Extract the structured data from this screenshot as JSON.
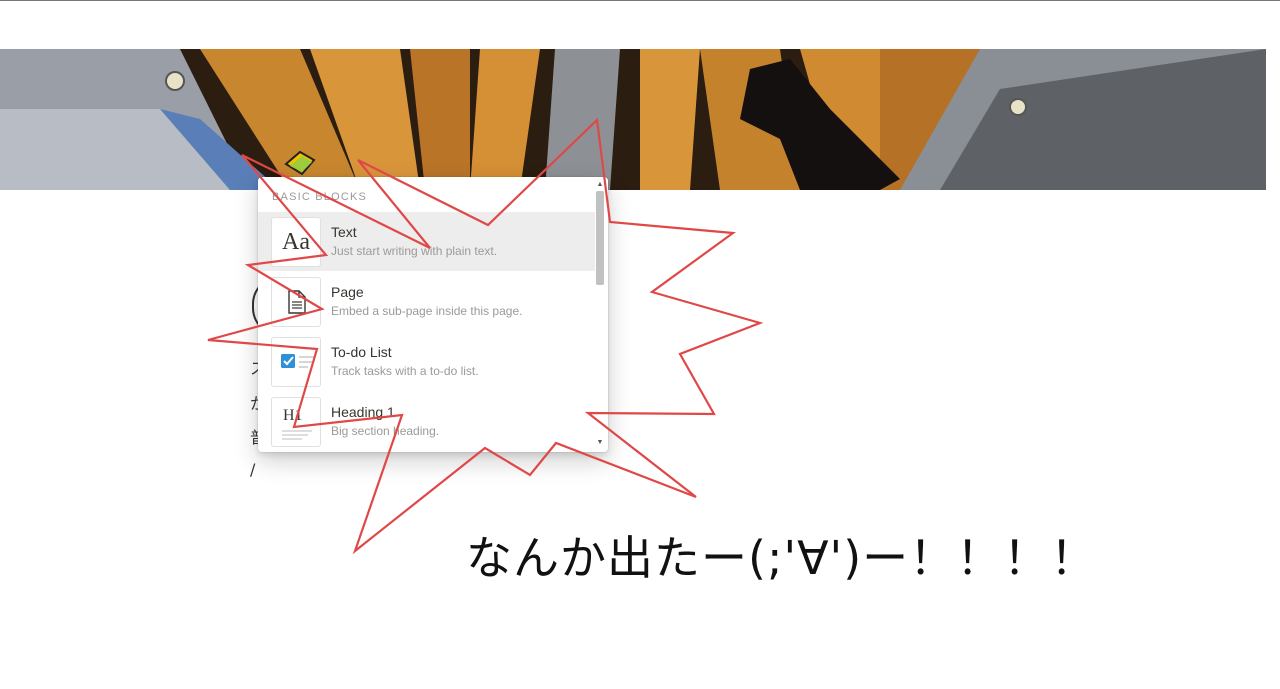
{
  "menu": {
    "section_label": "BASIC BLOCKS",
    "items": [
      {
        "title": "Text",
        "desc": "Just start writing with plain text.",
        "icon": "text-aa-icon",
        "thumb": "Aa"
      },
      {
        "title": "Page",
        "desc": "Embed a sub-page inside this page.",
        "icon": "page-icon"
      },
      {
        "title": "To-do List",
        "desc": "Track tasks with a to-do list.",
        "icon": "checkbox-icon"
      },
      {
        "title": "Heading 1",
        "desc": "Big section heading.",
        "icon": "heading-icon",
        "thumb": "H1"
      }
    ],
    "scroll_up": "▲",
    "scroll_down": "▼"
  },
  "page_body": {
    "line1": "ス",
    "line2": "か",
    "line3": "普",
    "slash": "/"
  },
  "annotation": {
    "caption": "なんか出たー(;'∀')ー！！！！",
    "burst_color": "#e04848"
  },
  "colors": {
    "menu_active_bg": "#ededed",
    "muted_text": "#9b9a97",
    "primary_text": "#37352f",
    "checkbox_blue": "#2e90d6"
  }
}
